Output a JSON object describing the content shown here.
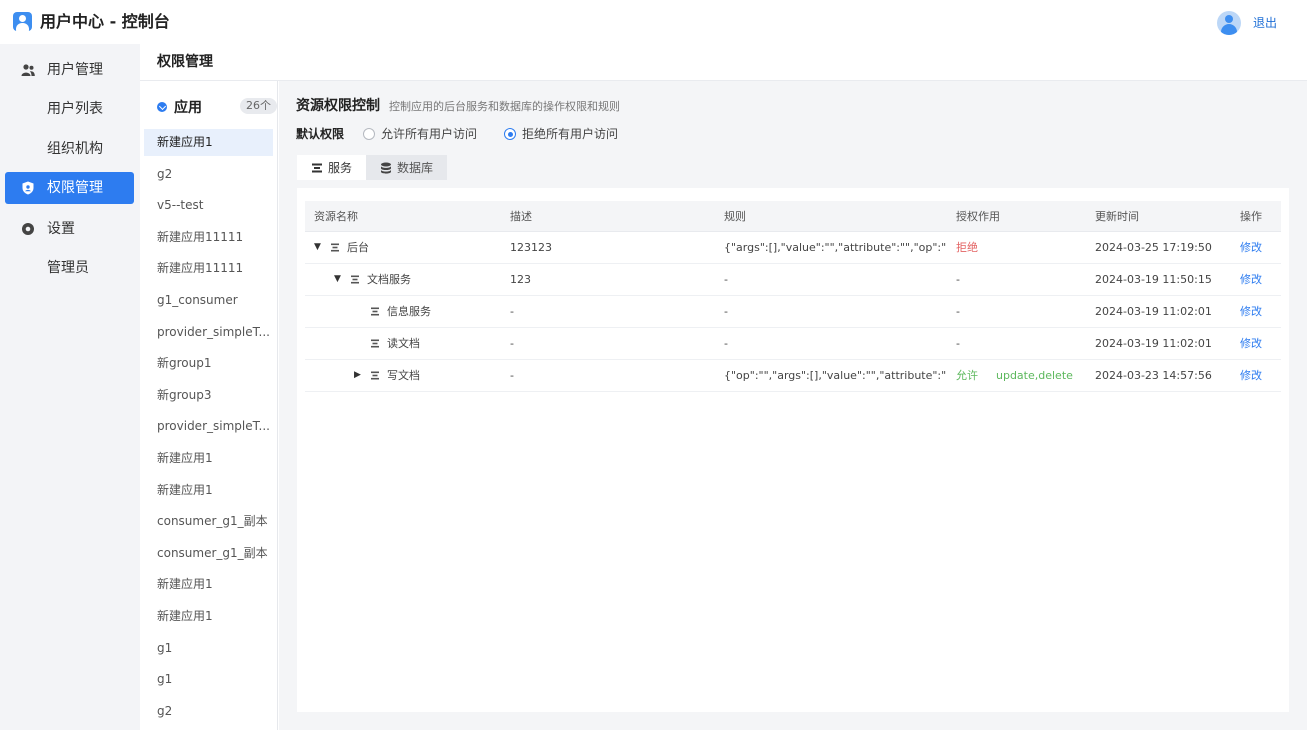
{
  "app": {
    "title": "用户中心 - 控制台",
    "logout_label": "退出"
  },
  "sidebar": {
    "items": [
      {
        "label": "用户管理",
        "icon": "users-icon",
        "level": "group"
      },
      {
        "label": "用户列表",
        "level": "sub"
      },
      {
        "label": "组织机构",
        "level": "sub"
      },
      {
        "label": "权限管理",
        "icon": "shield-icon",
        "level": "group",
        "active": true
      },
      {
        "label": "设置",
        "icon": "gear-icon",
        "level": "group"
      },
      {
        "label": "管理员",
        "level": "sub"
      }
    ]
  },
  "page": {
    "title": "权限管理"
  },
  "applist": {
    "header": "应用",
    "count": "26个",
    "items": [
      "新建应用1",
      "g2",
      "v5--test",
      "新建应用11111",
      "新建应用11111",
      "g1_consumer",
      "provider_simpleT...",
      "新group1",
      "新group3",
      "provider_simpleT...",
      "新建应用1",
      "新建应用1",
      "consumer_g1_副本",
      "consumer_g1_副本",
      "新建应用1",
      "新建应用1",
      "g1",
      "g1",
      "g2"
    ],
    "selected_index": 0
  },
  "resource": {
    "title": "资源权限控制",
    "description": "控制应用的后台服务和数据库的操作权限和规则",
    "default_perm_label": "默认权限",
    "radio_allow": "允许所有用户访问",
    "radio_deny": "拒绝所有用户访问",
    "radio_selected": "deny",
    "tabs": [
      {
        "label": "服务",
        "icon": "service-icon",
        "active": true
      },
      {
        "label": "数据库",
        "icon": "database-icon",
        "active": false
      }
    ]
  },
  "table": {
    "columns": [
      "资源名称",
      "描述",
      "规则",
      "授权作用",
      "更新时间",
      "操作"
    ],
    "rows": [
      {
        "name": "后台",
        "indent": 0,
        "caret": "down",
        "desc": "123123",
        "rule": "{\"args\":[],\"value\":\"\",\"attribute\":\"\",\"op\":\"\"}",
        "effect": "拒绝",
        "effect_type": "deny",
        "effect_ops": "",
        "updated": "2024-03-25 17:19:50",
        "action": "修改"
      },
      {
        "name": "文档服务",
        "indent": 1,
        "caret": "down",
        "desc": "123",
        "rule": "-",
        "effect": "-",
        "effect_type": "none",
        "effect_ops": "",
        "updated": "2024-03-19 11:50:15",
        "action": "修改"
      },
      {
        "name": "信息服务",
        "indent": 2,
        "caret": "none",
        "desc": "-",
        "rule": "-",
        "effect": "-",
        "effect_type": "none",
        "effect_ops": "",
        "updated": "2024-03-19 11:02:01",
        "action": "修改"
      },
      {
        "name": "读文档",
        "indent": 2,
        "caret": "none",
        "desc": "-",
        "rule": "-",
        "effect": "-",
        "effect_type": "none",
        "effect_ops": "",
        "updated": "2024-03-19 11:02:01",
        "action": "修改"
      },
      {
        "name": "写文档",
        "indent": 2,
        "caret": "right",
        "desc": "-",
        "rule": "{\"op\":\"\",\"args\":[],\"value\":\"\",\"attribute\":\"\"}",
        "effect": "允许",
        "effect_type": "allow",
        "effect_ops": "update,delete",
        "updated": "2024-03-23 14:57:56",
        "action": "修改"
      }
    ]
  },
  "colors": {
    "accent": "#2d7cf0",
    "deny": "#e36363",
    "allow": "#5cb85c"
  }
}
